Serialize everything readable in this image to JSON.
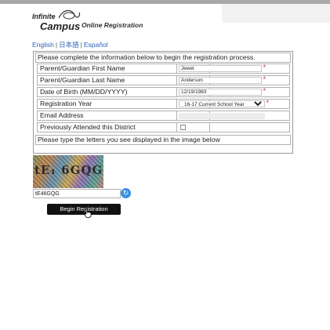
{
  "logo": {
    "line1": "Infinite",
    "line2": "Campus",
    "subtitle": "Online Registration"
  },
  "languages": [
    {
      "label": "English"
    },
    {
      "label": "日本語"
    },
    {
      "label": "Español"
    }
  ],
  "form": {
    "intro": "Please complete the information below to begin the registration process.",
    "fields": {
      "first_name": {
        "label": "Parent/Guardian First Name",
        "value": "Jewel",
        "required": "*"
      },
      "last_name": {
        "label": "Parent/Guardian Last Name",
        "value": "Anderson",
        "required": "*"
      },
      "dob": {
        "label": "Date of Birth (MM/DD/YYYY)",
        "value": "12/19/1983",
        "required": "*"
      },
      "year": {
        "label": "Registration Year",
        "value": "16-17 Current School Year",
        "required": "*"
      },
      "email": {
        "label": "Email Address"
      },
      "previously": {
        "label": "Previously Attended this District"
      }
    },
    "captcha_instruction": "Please type the letters you see displayed in the image below"
  },
  "captcha": {
    "image_text": "tE₁ 6GQG",
    "input_value": "tE46GQG"
  },
  "button": {
    "label": "Begin Registration"
  },
  "colors": {
    "link": "#2b63b8",
    "required": "#d92020",
    "button": "#111111",
    "refresh": "#3a8fe0"
  }
}
